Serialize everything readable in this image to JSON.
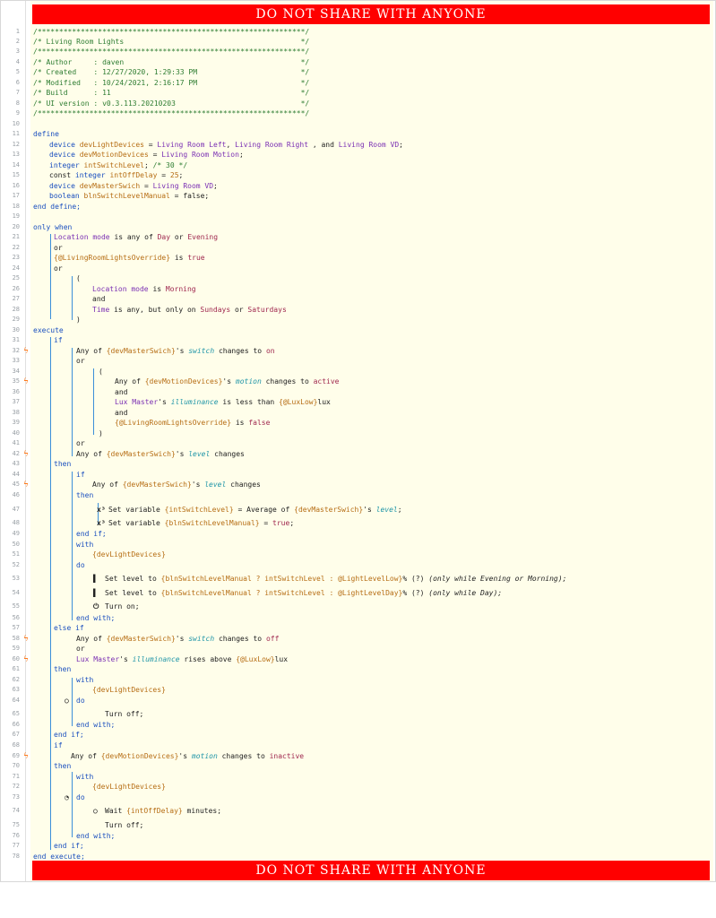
{
  "banner": {
    "text": "DO NOT SHARE WITH ANYONE"
  },
  "colors": {
    "banner": "#ff0000",
    "comment": "#2e7d32",
    "keyword": "#1a4fbf",
    "device": "#7a2fb3",
    "value": "#a0284f",
    "variable": "#b66d14",
    "attribute": "#2196a8",
    "bolt": "#ff6a00"
  },
  "lines": [
    {
      "n": "1",
      "t": "/**************************************************************/"
    },
    {
      "n": "2",
      "t": "/* Living Room Lights                                         */"
    },
    {
      "n": "3",
      "t": "/**************************************************************/"
    },
    {
      "n": "4",
      "t": "/* Author     : daven                                         */"
    },
    {
      "n": "5",
      "t": "/* Created    : 12/27/2020, 1:29:33 PM                        */"
    },
    {
      "n": "6",
      "t": "/* Modified   : 10/24/2021, 2:16:17 PM                        */"
    },
    {
      "n": "7",
      "t": "/* Build      : 11                                            */"
    },
    {
      "n": "8",
      "t": "/* UI version : v0.3.113.20210203                             */"
    },
    {
      "n": "9",
      "t": "/**************************************************************/"
    },
    {
      "n": "10"
    },
    {
      "n": "11"
    },
    {
      "n": "12"
    },
    {
      "n": "13"
    },
    {
      "n": "14"
    },
    {
      "n": "15"
    },
    {
      "n": "16"
    },
    {
      "n": "17"
    },
    {
      "n": "18"
    },
    {
      "n": "19"
    },
    {
      "n": "20"
    },
    {
      "n": "21"
    },
    {
      "n": "22"
    },
    {
      "n": "23"
    },
    {
      "n": "24"
    },
    {
      "n": "25"
    },
    {
      "n": "26"
    },
    {
      "n": "27"
    },
    {
      "n": "28"
    },
    {
      "n": "29"
    },
    {
      "n": "30"
    },
    {
      "n": "31"
    },
    {
      "n": "32"
    },
    {
      "n": "33"
    },
    {
      "n": "34"
    },
    {
      "n": "35"
    },
    {
      "n": "36"
    },
    {
      "n": "37"
    },
    {
      "n": "38"
    },
    {
      "n": "39"
    },
    {
      "n": "40"
    },
    {
      "n": "41"
    },
    {
      "n": "42"
    },
    {
      "n": "43"
    },
    {
      "n": "44"
    },
    {
      "n": "45"
    },
    {
      "n": "46"
    },
    {
      "n": "47"
    },
    {
      "n": "48"
    },
    {
      "n": "49"
    },
    {
      "n": "50"
    },
    {
      "n": "51"
    },
    {
      "n": "52"
    },
    {
      "n": "53"
    },
    {
      "n": "54"
    },
    {
      "n": "55"
    },
    {
      "n": "56"
    },
    {
      "n": "57"
    },
    {
      "n": "58"
    },
    {
      "n": "59"
    },
    {
      "n": "60"
    },
    {
      "n": "61"
    },
    {
      "n": "62"
    },
    {
      "n": "63"
    },
    {
      "n": "64"
    },
    {
      "n": "65"
    },
    {
      "n": "66"
    },
    {
      "n": "67"
    },
    {
      "n": "68"
    },
    {
      "n": "69"
    },
    {
      "n": "70"
    },
    {
      "n": "71"
    },
    {
      "n": "72"
    },
    {
      "n": "73"
    },
    {
      "n": "74"
    },
    {
      "n": "75"
    },
    {
      "n": "76"
    },
    {
      "n": "77"
    },
    {
      "n": "78"
    }
  ],
  "code": {
    "define": "define",
    "l12_a": "device ",
    "l12_var": "devLightDevices",
    "l12_eq": " = ",
    "l12_d1": "Living Room Left",
    "l12_c1": ", ",
    "l12_d2": "Living Room Right",
    "l12_c2": " , and ",
    "l12_d3": "Living Room VD",
    "l12_end": ";",
    "l13_a": "device ",
    "l13_var": "devMotionDevices",
    "l13_eq": " = ",
    "l13_d": "Living Room Motion",
    "l13_end": ";",
    "l14_a": "integer ",
    "l14_var": "intSwitchLevel",
    "l14_end": "; ",
    "l14_cm": "/* 30 */",
    "l15_a": "const ",
    "l15_b": "integer ",
    "l15_var": "intOffDelay",
    "l15_eq": " = ",
    "l15_num": "25",
    "l15_end": ";",
    "l16_a": "device ",
    "l16_var": "devMasterSwich",
    "l16_eq": " = ",
    "l16_d": "Living Room VD",
    "l16_end": ";",
    "l17_a": "boolean ",
    "l17_var": "blnSwitchLevelManual",
    "l17_eq": " = ",
    "l17_val": "false",
    "l17_end": ";",
    "l18": "end define;",
    "l20": "only when",
    "l21_a": "Location mode",
    "l21_b": " is any of ",
    "l21_c": "Day",
    "l21_d": " or ",
    "l21_e": "Evening",
    "l22": "or",
    "l23_a": "{@LivingRoomLightsOverride}",
    "l23_b": " is ",
    "l23_c": "true",
    "l24": "or",
    "l25": "(",
    "l26_a": "Location mode",
    "l26_b": " is ",
    "l26_c": "Morning",
    "l27": "and",
    "l28_a": "Time",
    "l28_b": " is any, but only on ",
    "l28_c": "Sundays",
    "l28_d": " or ",
    "l28_e": "Saturdays",
    "l29": ")",
    "l30": "execute",
    "l31": "if",
    "l32_a": "Any of ",
    "l32_b": "{devMasterSwich}",
    "l32_c": "'s ",
    "l32_d": "switch",
    "l32_e": " changes to ",
    "l32_f": "on",
    "l33": "or",
    "l34": "(",
    "l35_a": "Any of ",
    "l35_b": "{devMotionDevices}",
    "l35_c": "'s ",
    "l35_d": "motion",
    "l35_e": " changes to ",
    "l35_f": "active",
    "l36": "and",
    "l37_a": "Lux Master",
    "l37_b": "'s ",
    "l37_c": "illuminance",
    "l37_d": " is less than ",
    "l37_e": "{@LuxLow}",
    "l37_f": "lux",
    "l38": "and",
    "l39_a": "{@LivingRoomLightsOverride}",
    "l39_b": " is ",
    "l39_c": "false",
    "l40": ")",
    "l41": "or",
    "l42_a": "Any of ",
    "l42_b": "{devMasterSwich}",
    "l42_c": "'s ",
    "l42_d": "level",
    "l42_e": " changes",
    "l43": "then",
    "l44": "if",
    "l45_a": "Any of ",
    "l45_b": "{devMasterSwich}",
    "l45_c": "'s ",
    "l45_d": "level",
    "l45_e": " changes",
    "l46": "then",
    "l47_a": "Set variable ",
    "l47_b": "{intSwitchLevel}",
    "l47_c": " = Average of ",
    "l47_d": "{devMasterSwich}",
    "l47_e": "'s ",
    "l47_f": "level",
    "l47_g": ";",
    "l48_a": "Set variable ",
    "l48_b": "{blnSwitchLevelManual}",
    "l48_c": " = ",
    "l48_d": "true",
    "l48_e": ";",
    "l49": "end if;",
    "l50": "with",
    "l51": "{devLightDevices}",
    "l52": "do",
    "l53_a": "Set level to ",
    "l53_b": "{blnSwitchLevelManual ? intSwitchLevel : @LightLevelLow}",
    "l53_c": "% (?) ",
    "l53_d": "(only while ",
    "l53_e": "Evening",
    "l53_f": " or ",
    "l53_g": "Morning",
    "l53_h": ");",
    "l54_a": "Set level to ",
    "l54_b": "{blnSwitchLevelManual ? intSwitchLevel : @LightLevelDay}",
    "l54_c": "% (?) ",
    "l54_d": "(only while ",
    "l54_e": "Day",
    "l54_f": ");",
    "l55": "Turn on;",
    "l56": "end with;",
    "l57": "else if",
    "l58_a": "Any of ",
    "l58_b": "{devMasterSwich}",
    "l58_c": "'s ",
    "l58_d": "switch",
    "l58_e": " changes to ",
    "l58_f": "off",
    "l59": "or",
    "l60_a": "Lux Master",
    "l60_b": "'s ",
    "l60_c": "illuminance",
    "l60_d": " rises above ",
    "l60_e": "{@LuxLow}",
    "l60_f": "lux",
    "l61": "then",
    "l62": "with",
    "l63": "{devLightDevices}",
    "l64": "do",
    "l65": "Turn off;",
    "l66": "end with;",
    "l67": "end if;",
    "l68": "if",
    "l69_a": "Any of ",
    "l69_b": "{devMotionDevices}",
    "l69_c": "'s ",
    "l69_d": "motion",
    "l69_e": " changes to ",
    "l69_f": "inactive",
    "l70": "then",
    "l71": "with",
    "l72": "{devLightDevices}",
    "l73": "do",
    "l74_a": "Wait ",
    "l74_b": "{intOffDelay}",
    "l74_c": " minutes;",
    "l75": "Turn off;",
    "l76": "end with;",
    "l77": "end if;",
    "l78": "end execute;"
  }
}
